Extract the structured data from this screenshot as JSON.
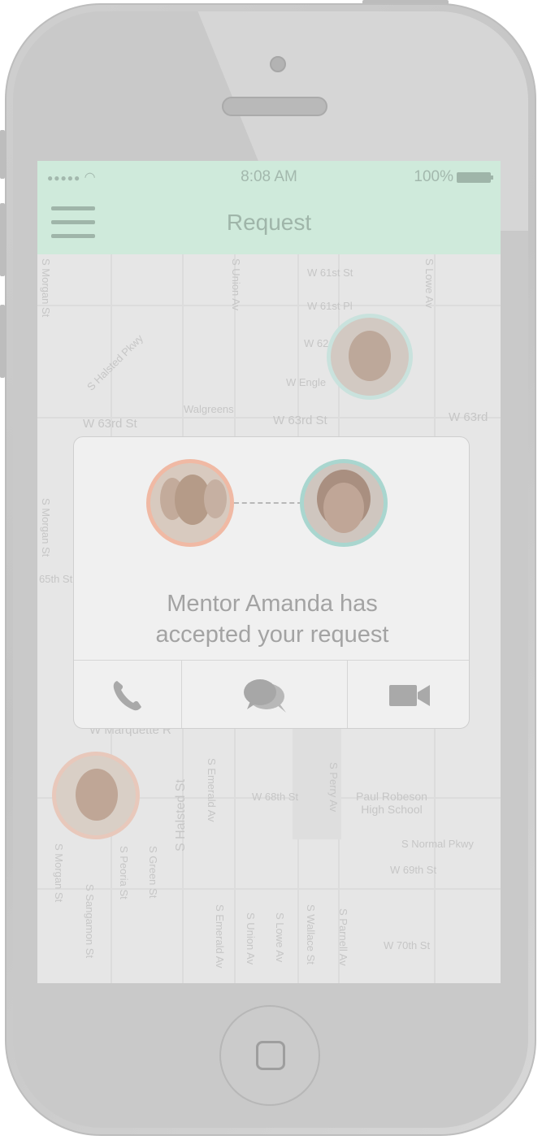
{
  "status_bar": {
    "signal": "●●●●● ",
    "time": "8:08 AM",
    "battery": "100%"
  },
  "nav": {
    "title": "Request"
  },
  "map": {
    "labels": {
      "w61st": "W 61st St",
      "w61stpl": "W 61st Pl",
      "w62": "W 62",
      "wengle": "W Engle",
      "walgreens": "Walgreens",
      "w63rd_left": "W 63rd St",
      "w63rd_mid": "W 63rd St",
      "w63rd_right": "W 63rd",
      "halsted_pkwy": "S Halsted Pkwy",
      "morgan_top": "S Morgan St",
      "union_top": "S Union Av",
      "lowe_top": "S Lowe Av",
      "morgan_mid": "S Morgan St",
      "st65th": "65th St",
      "marquette": "W Marquette R",
      "halsted_st": "S Halsted St",
      "emerald_av": "S Emerald Av",
      "w68th": "W 68th St",
      "perry_av": "S Perry Av",
      "paul_robeson": "Paul Robeson\nHigh School",
      "normal_pkwy": "S Normal Pkwy",
      "w69th": "W 69th St",
      "w70th": "W 70th St",
      "morgan_bottom": "S Morgan St",
      "sangamon": "S Sangamon St",
      "peoria": "S Peoria St",
      "green": "S Green St",
      "emerald_bottom": "S Emerald Av",
      "union_bottom": "S Union Av",
      "lowe_bottom": "S Lowe Av",
      "wallace": "S Wallace St",
      "parnell": "S Parnell Av"
    }
  },
  "dialog": {
    "message_line1": "Mentor Amanda has",
    "message_line2": "accepted your request",
    "actions": [
      {
        "label": "Call",
        "icon": "phone-icon"
      },
      {
        "label": "Message",
        "icon": "chat-bubbles-icon"
      },
      {
        "label": "Video",
        "icon": "video-camera-icon"
      }
    ]
  },
  "colors": {
    "header_bg": "#cfeadb",
    "mentee_ring": "#f0b9a4",
    "mentor_ring": "#a9d6cf"
  }
}
